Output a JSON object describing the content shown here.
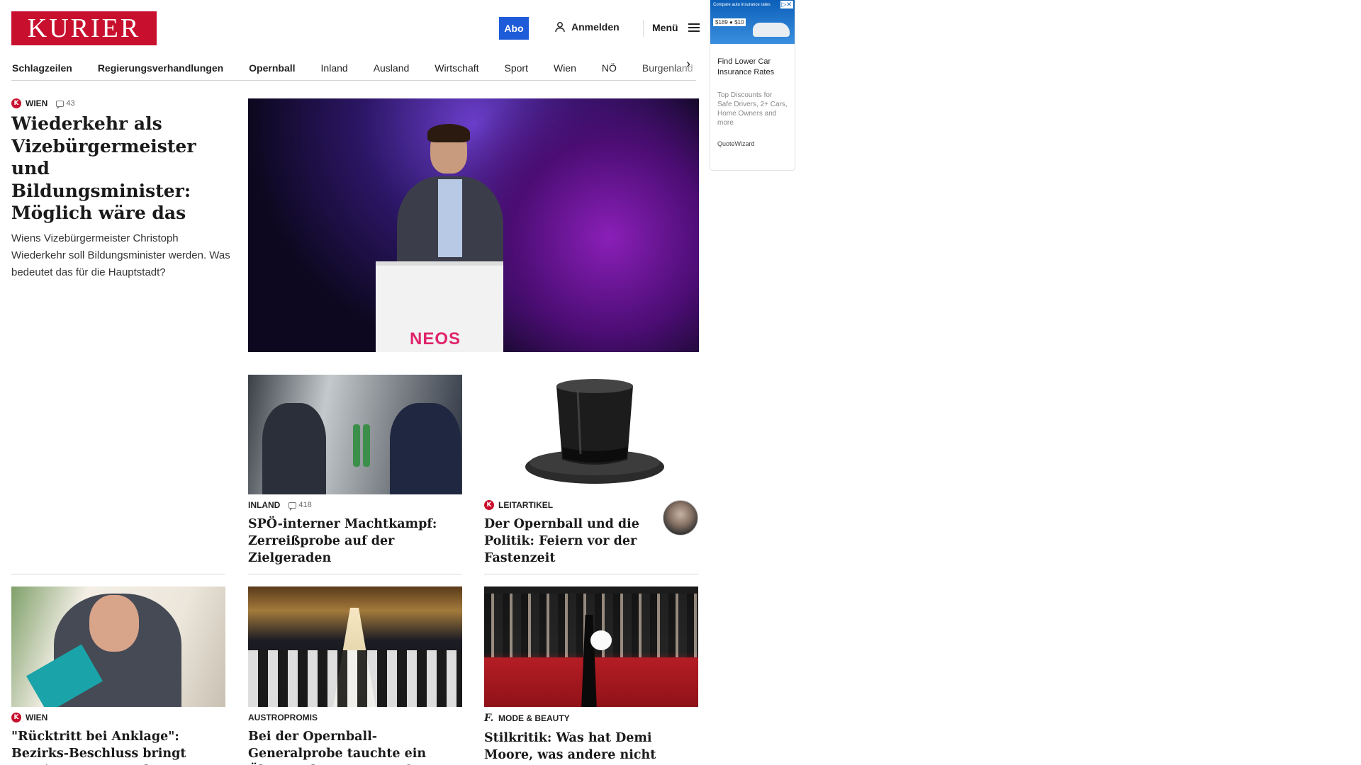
{
  "header": {
    "logo_text": "KURIER",
    "abo_label": "Abo",
    "login_label": "Anmelden",
    "menu_label": "Menü"
  },
  "nav": {
    "items": [
      "Schlagzeilen",
      "Regierungsverhandlungen",
      "Opernball",
      "Inland",
      "Ausland",
      "Wirtschaft",
      "Sport",
      "Wien",
      "NÖ",
      "Burgenland"
    ]
  },
  "ad": {
    "banner_text": "Compare auto insurance rates",
    "price_text": "$189 ● $10",
    "title": "Find Lower Car Insurance Rates",
    "description": "Top Discounts for Safe Drivers, 2+ Cars, Home Owners and more",
    "brand": "QuoteWizard"
  },
  "lead": {
    "category": "WIEN",
    "comments": "43",
    "headline": "Wiederkehr als Vizebürgermeister und Bildungsminister: Möglich wäre das",
    "teaser": "Wiens Vizebürgermeister Christoph Wiederkehr soll Bildungsminister werden. Was bedeutet das für die Hauptstadt?"
  },
  "hero": {
    "podium_text": "NEOS"
  },
  "articles": [
    {
      "category": "INLAND",
      "comments": "418",
      "headline": "SPÖ-interner Machtkampf: Zerreißprobe auf der Zielgeraden"
    },
    {
      "category": "LEITARTIKEL",
      "headline": "Der Opernball und die Politik: Feiern vor der Fastenzeit"
    },
    {
      "category": "WIEN",
      "headline": "\"Rücktritt bei Anklage\": Bezirks-Beschluss bringt Nevrivy unter Druck"
    },
    {
      "category": "AUSTROPROMIS",
      "headline": "Bei der Opernball-Generalprobe tauchte ein Überraschungsgast auf"
    },
    {
      "category": "MODE & BEAUTY",
      "headline": "Stilkritik: Was hat Demi Moore, was andere nicht haben?"
    }
  ],
  "colors": {
    "brand": "#c8102e",
    "abo_button": "#1e5bd8"
  }
}
